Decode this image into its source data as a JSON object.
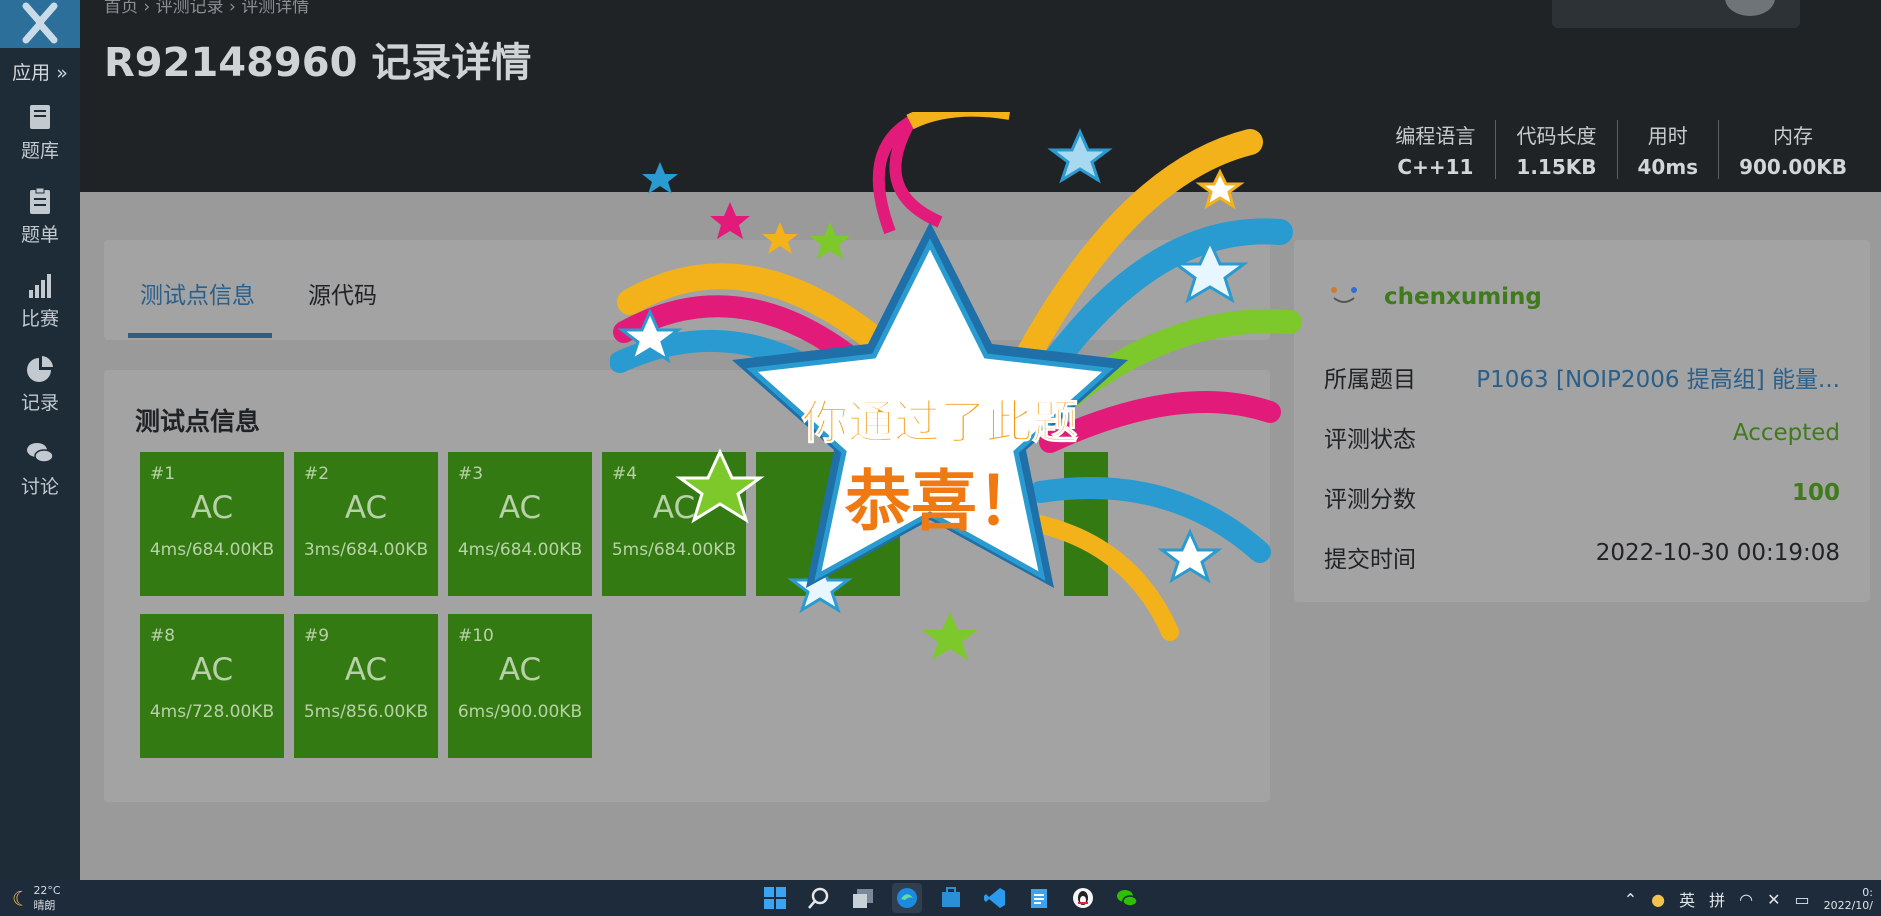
{
  "sidebar": {
    "apps_label": "应用 »",
    "items": [
      {
        "label": "题库",
        "icon": "book-icon"
      },
      {
        "label": "题单",
        "icon": "clipboard-icon"
      },
      {
        "label": "比赛",
        "icon": "signal-bars-icon"
      },
      {
        "label": "记录",
        "icon": "pie-chart-icon"
      },
      {
        "label": "讨论",
        "icon": "chat-icon"
      }
    ]
  },
  "header": {
    "breadcrumb": "首页 › 评测记录 › 评测详情",
    "title": "R92148960 记录详情",
    "stats": [
      {
        "key": "编程语言",
        "value": "C++11"
      },
      {
        "key": "代码长度",
        "value": "1.15KB"
      },
      {
        "key": "用时",
        "value": "40ms"
      },
      {
        "key": "内存",
        "value": "900.00KB"
      }
    ]
  },
  "tabs": [
    {
      "label": "测试点信息",
      "active": true
    },
    {
      "label": "源代码",
      "active": false
    }
  ],
  "cases_title": "测试点信息",
  "cases": [
    {
      "id": "#1",
      "status": "AC",
      "info": "4ms/684.00KB"
    },
    {
      "id": "#2",
      "status": "AC",
      "info": "3ms/684.00KB"
    },
    {
      "id": "#3",
      "status": "AC",
      "info": "4ms/684.00KB"
    },
    {
      "id": "#4",
      "status": "AC",
      "info": "5ms/684.00KB"
    },
    {
      "id": "#8",
      "status": "AC",
      "info": "4ms/728.00KB"
    },
    {
      "id": "#9",
      "status": "AC",
      "info": "5ms/856.00KB"
    },
    {
      "id": "#10",
      "status": "AC",
      "info": "6ms/900.00KB"
    }
  ],
  "info": {
    "user": "chenxuming",
    "problem_label": "所属题目",
    "problem_value": "P1063 [NOIP2006 提高组] 能量...",
    "status_label": "评测状态",
    "status_value": "Accepted",
    "score_label": "评测分数",
    "score_value": "100",
    "time_label": "提交时间",
    "time_value": "2022-10-30 00:19:08"
  },
  "celebrate": {
    "line1": "你通过了此题",
    "line2": "恭喜！"
  },
  "taskbar": {
    "temp": "22°C",
    "weather": "晴朗",
    "ime1": "英",
    "ime2": "拼",
    "clock_time": "0:",
    "clock_date": "2022/10/"
  },
  "colors": {
    "accent": "#2a5f8a",
    "ac_green": "#337a12",
    "accepted": "#3f7a1c"
  }
}
